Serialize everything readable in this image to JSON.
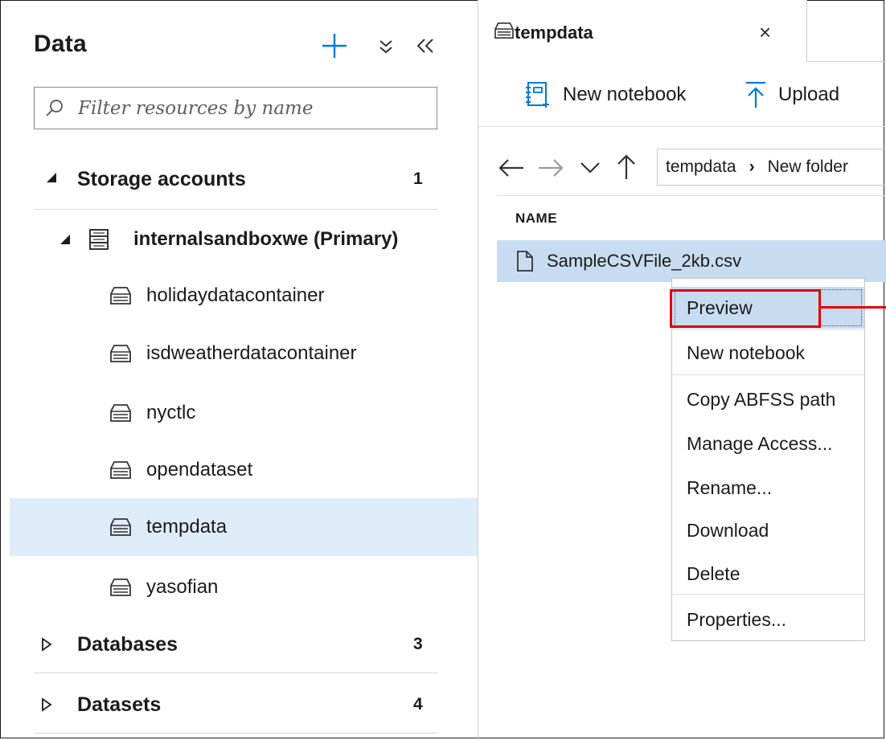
{
  "left_panel": {
    "title": "Data",
    "actions": {
      "add": "add-icon",
      "collapse_all": "collapse-all-icon",
      "hide_panel": "hide-panel-icon"
    },
    "filter_placeholder": "Filter resources by name",
    "groups": [
      {
        "label": "Storage accounts",
        "count": "1",
        "expanded": true
      },
      {
        "label": "Databases",
        "count": "3",
        "expanded": false
      },
      {
        "label": "Datasets",
        "count": "4",
        "expanded": false
      }
    ],
    "account": {
      "label": "internalsandboxwe (Primary)"
    },
    "containers": [
      {
        "label": "holidaydatacontainer"
      },
      {
        "label": "isdweatherdatacontainer"
      },
      {
        "label": "nyctlc"
      },
      {
        "label": "opendataset"
      },
      {
        "label": "tempdata",
        "selected": true
      },
      {
        "label": "yasofian"
      }
    ]
  },
  "tab": {
    "label": "tempdata",
    "close_glyph": "×"
  },
  "toolbar": {
    "new_notebook": "New notebook",
    "upload": "Upload"
  },
  "breadcrumb": {
    "root": "tempdata",
    "separator": "›",
    "current": "New folder"
  },
  "file_list": {
    "column_header": "NAME",
    "files": [
      {
        "name": "SampleCSVFile_2kb.csv",
        "selected": true
      }
    ]
  },
  "context_menu": {
    "items": [
      {
        "label": "Preview",
        "active": true
      },
      {
        "label": "New notebook"
      },
      {
        "label": "Copy ABFSS path"
      },
      {
        "label": "Manage Access..."
      },
      {
        "label": "Rename..."
      },
      {
        "label": "Download"
      },
      {
        "label": "Delete"
      },
      {
        "label": "Properties..."
      }
    ]
  },
  "colors": {
    "accent": "#0078d4",
    "selection": "#deecf9",
    "file_selection": "#c7dcf0",
    "annotation": "#e00000"
  }
}
